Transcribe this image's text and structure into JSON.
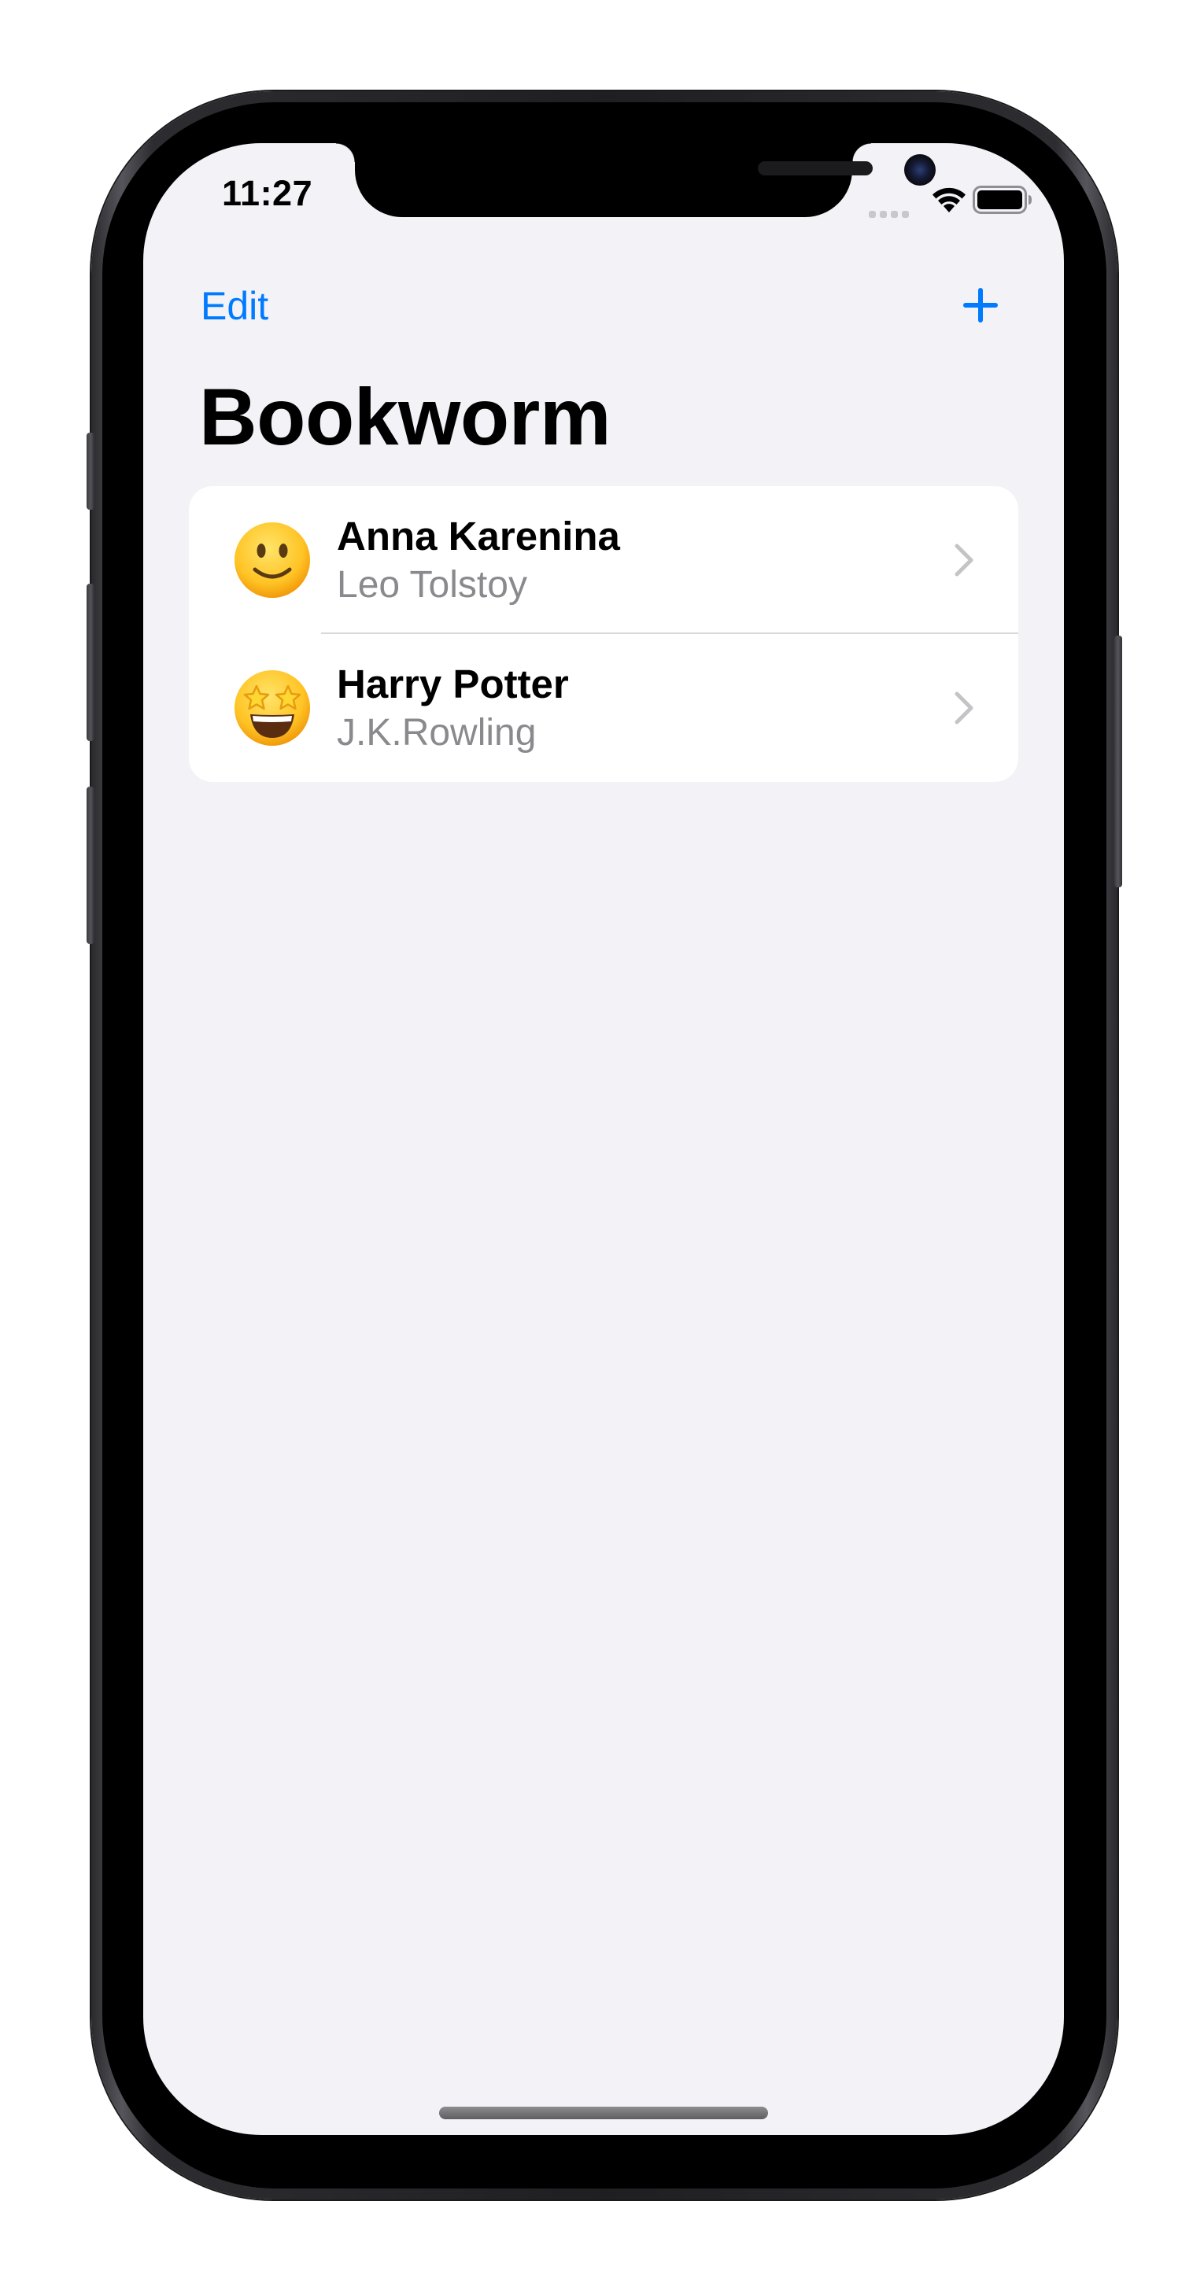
{
  "status_bar": {
    "time": "11:27"
  },
  "nav": {
    "edit_label": "Edit",
    "add_icon": "plus-icon",
    "title": "Bookworm"
  },
  "books": [
    {
      "title": "Anna Karenina",
      "author": "Leo Tolstoy",
      "icon": "slightly-smiling-face-emoji"
    },
    {
      "title": "Harry Potter",
      "author": "J.K.Rowling",
      "icon": "star-struck-face-emoji"
    }
  ],
  "colors": {
    "accent": "#007aff",
    "background": "#f2f2f7",
    "secondary_text": "#8a8a8e"
  }
}
